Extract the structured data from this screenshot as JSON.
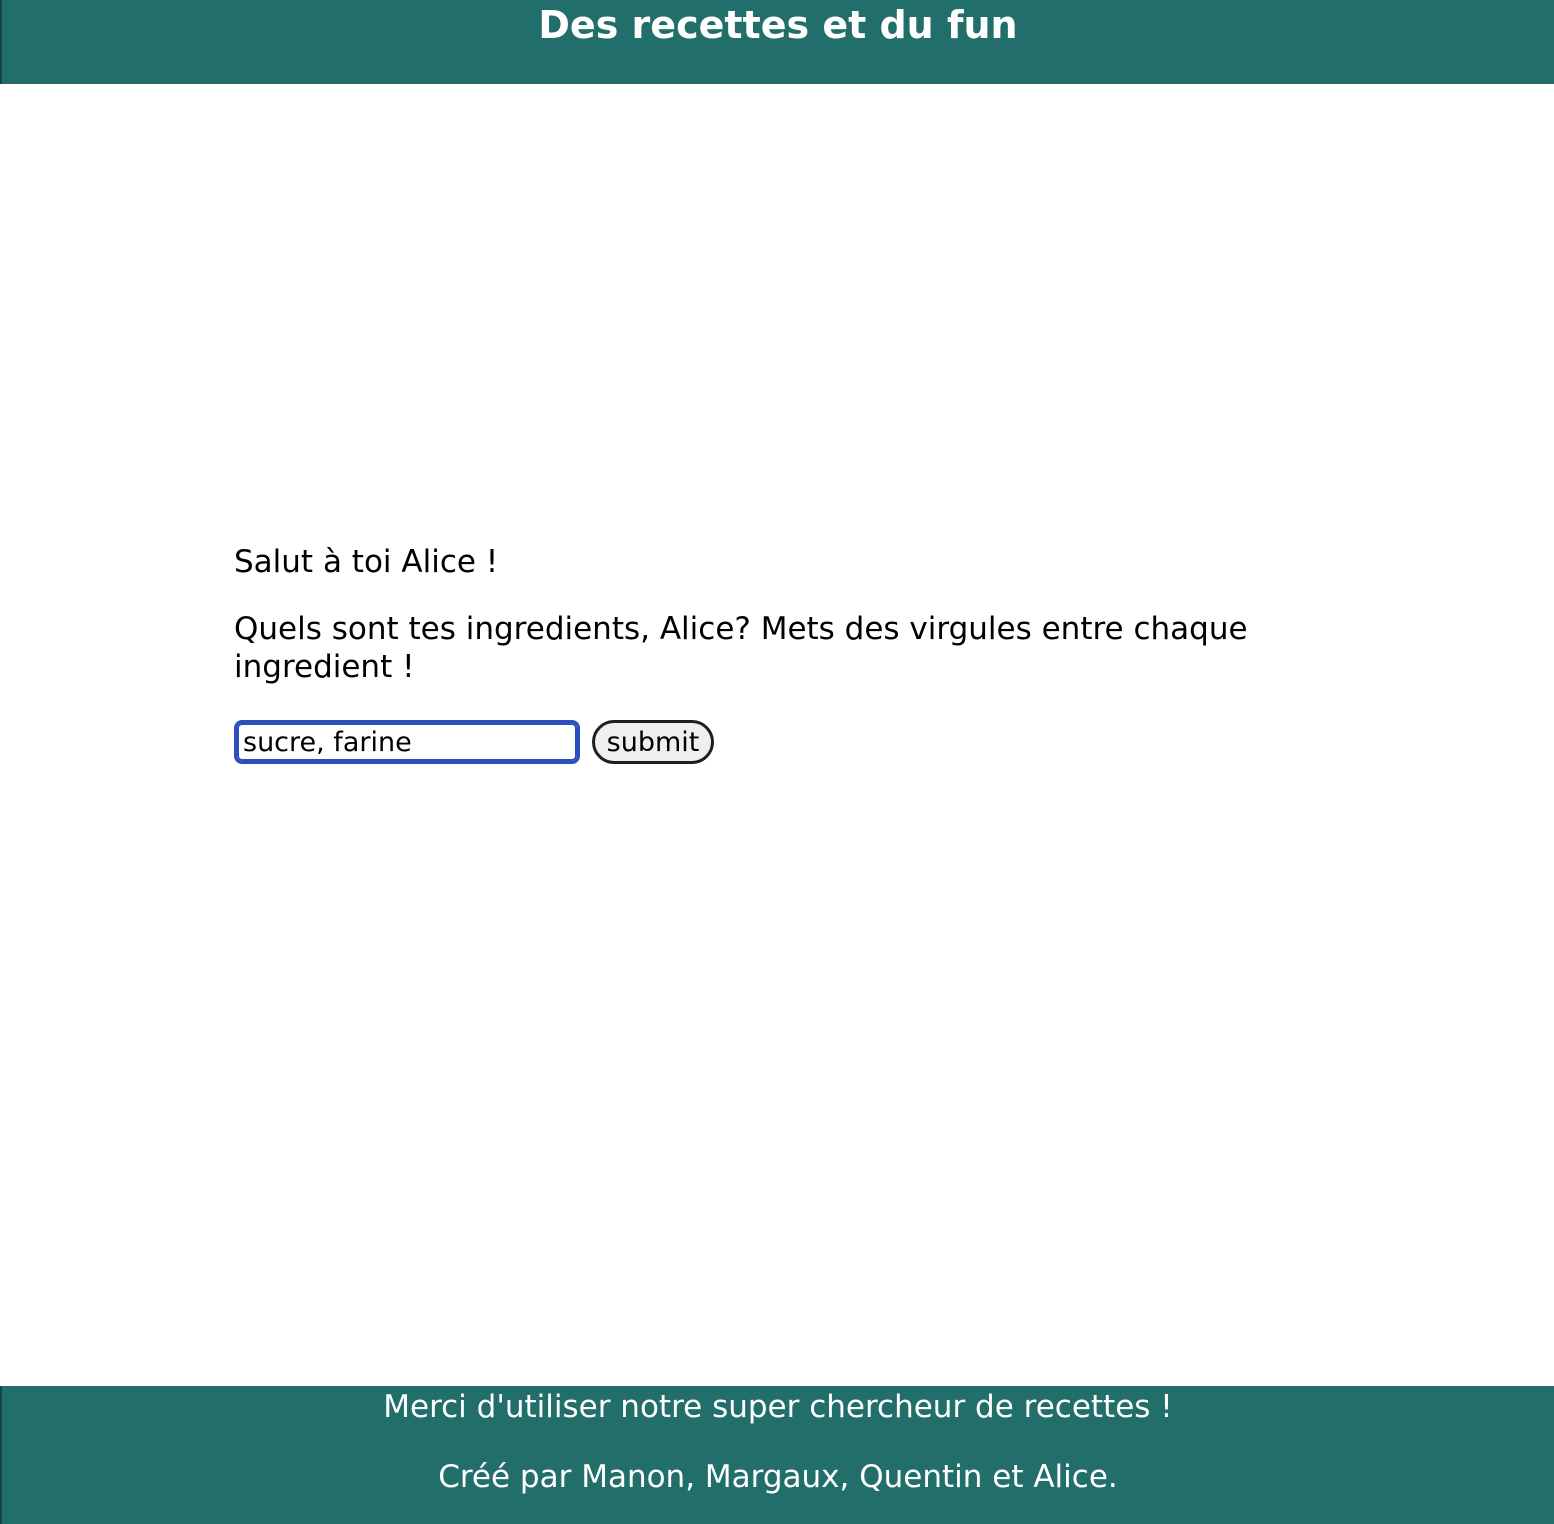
{
  "header": {
    "title": "Des recettes et du fun"
  },
  "main": {
    "greeting": "Salut à toi Alice !",
    "question": "Quels sont tes ingredients, Alice? Mets des virgules entre chaque ingredient !",
    "ingredients_input": {
      "value": "sucre, farine",
      "focused": true
    },
    "submit_label": "submit"
  },
  "footer": {
    "thanks": "Merci d'utiliser notre super chercheur de recettes !",
    "credits": "Créé par Manon, Margaux, Quentin et Alice."
  },
  "colors": {
    "header_footer_bg": "#226e6b",
    "focus_ring": "#2c4fc0",
    "text": "#000000",
    "footer_text": "#ffffff"
  }
}
